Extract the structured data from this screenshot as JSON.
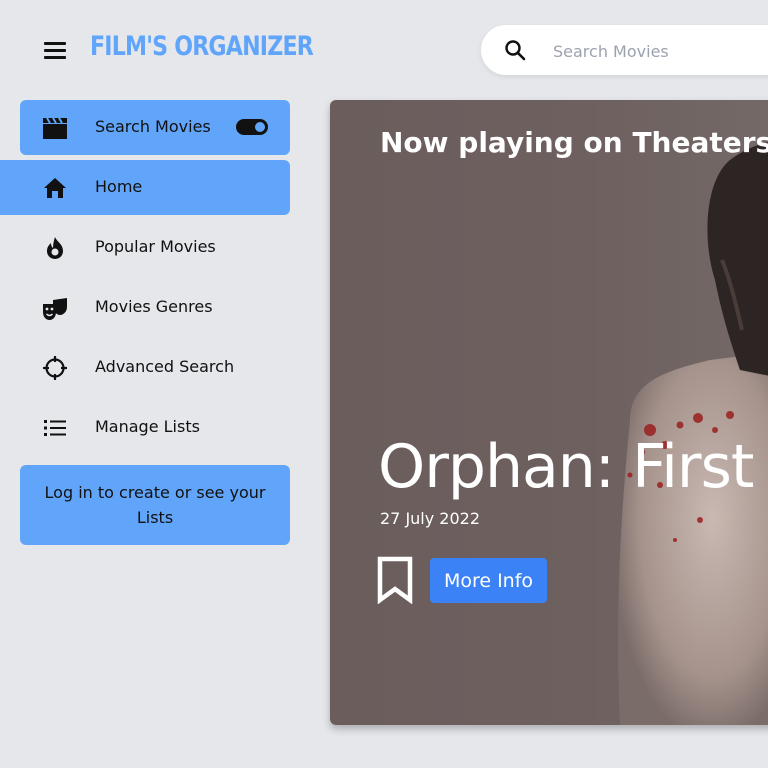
{
  "header": {
    "menu_icon": "hamburger-menu-icon",
    "brand": "FILM'S ORGANIZER",
    "search": {
      "placeholder": "Search Movies",
      "value": "",
      "icon": "search-icon"
    }
  },
  "sidebar": {
    "items": [
      {
        "label": "Search Movies",
        "icon": "clapperboard-icon",
        "toggle_on": true
      },
      {
        "label": "Home",
        "icon": "home-icon",
        "active": true
      },
      {
        "label": "Popular Movies",
        "icon": "fire-icon"
      },
      {
        "label": "Movies Genres",
        "icon": "theater-masks-icon"
      },
      {
        "label": "Advanced Search",
        "icon": "crosshair-icon"
      },
      {
        "label": "Manage Lists",
        "icon": "list-icon"
      }
    ],
    "login_text": "Log in to create or see your Lists"
  },
  "hero": {
    "heading": "Now playing on Theaters",
    "movie_title": "Orphan: First Kill",
    "release_date": "27 July 2022",
    "more_info_label": "More Info",
    "bookmark_icon": "bookmark-icon"
  },
  "colors": {
    "accent": "#60a5fa",
    "button": "#3b82f6",
    "background": "#e5e7eb"
  }
}
